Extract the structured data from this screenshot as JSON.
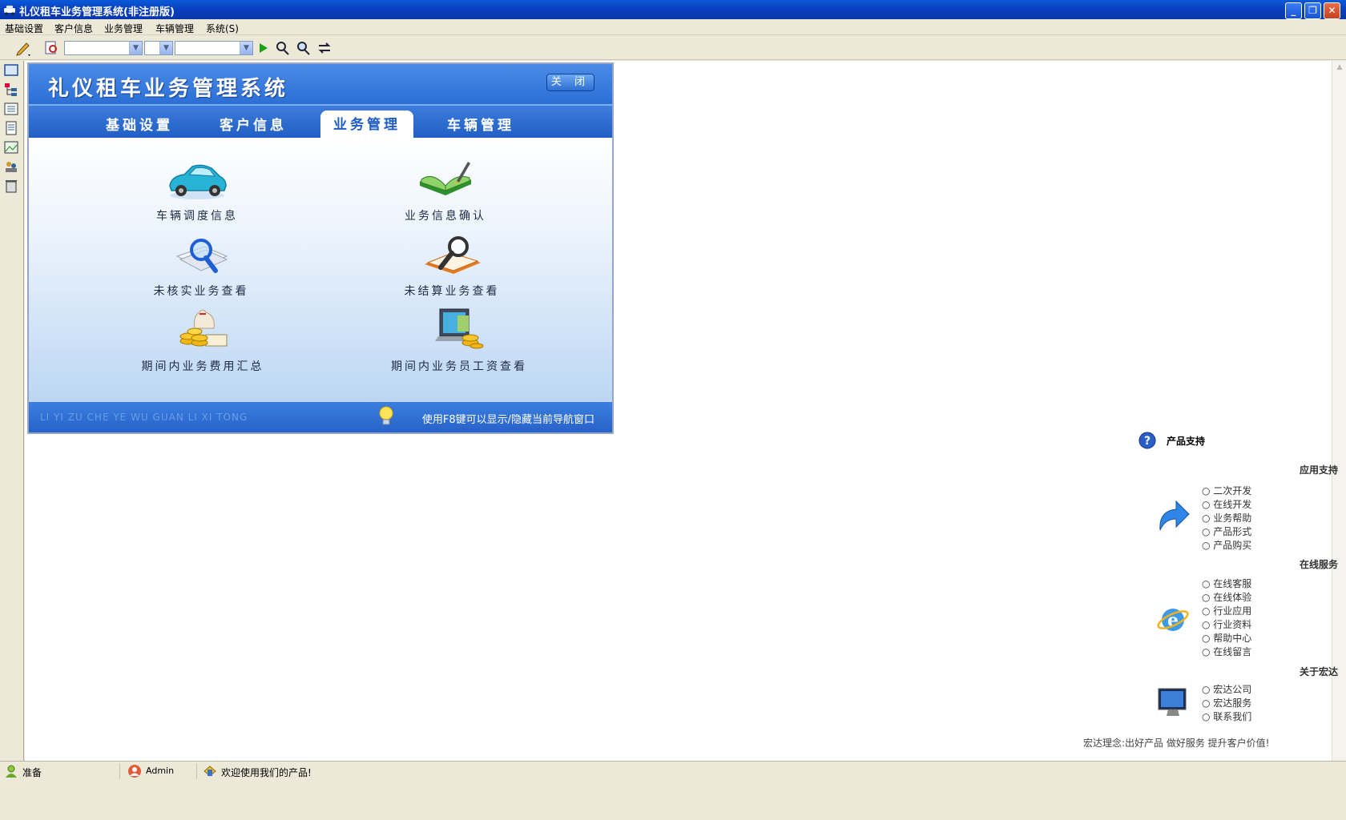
{
  "window": {
    "title": "礼仪租车业务管理系统(非注册版)"
  },
  "menu": [
    "基础设置",
    "客户信息",
    "业务管理",
    "车辆管理",
    "系统(S)"
  ],
  "nav": {
    "title": "礼仪租车业务管理系统",
    "close_label": "关 闭",
    "tabs": [
      "基础设置",
      "客户信息",
      "业务管理",
      "车辆管理"
    ],
    "active_tab": "业务管理",
    "items": [
      {
        "label": "车辆调度信息",
        "icon": "car-icon"
      },
      {
        "label": "业务信息确认",
        "icon": "book-pen-icon"
      },
      {
        "label": "未核实业务查看",
        "icon": "magnifier-document-icon"
      },
      {
        "label": "未结算业务查看",
        "icon": "magnifier-book-icon"
      },
      {
        "label": "期间内业务费用汇总",
        "icon": "coins-money-icon"
      },
      {
        "label": "期间内业务员工资查看",
        "icon": "computer-coins-icon"
      }
    ],
    "footer_pinyin": "LI YI ZU CHE YE WU GUAN LI XI TONG",
    "footer_hint": "使用F8键可以显示/隐藏当前导航窗口"
  },
  "support": {
    "heading": "产品支持",
    "sections": [
      {
        "title": "应用支持",
        "links": [
          "二次开发",
          "在线开发",
          "业务帮助",
          "产品形式",
          "产品购买"
        ]
      },
      {
        "title": "在线服务",
        "links": [
          "在线客服",
          "在线体验",
          "行业应用",
          "行业资料",
          "帮助中心",
          "在线留言"
        ]
      },
      {
        "title": "关于宏达",
        "links": [
          "宏达公司",
          "宏达服务",
          "联系我们"
        ]
      }
    ],
    "motto": "宏达理念:出好产品 做好服务 提升客户价值!"
  },
  "status": {
    "ready": "准备",
    "user": "Admin",
    "welcome": "欢迎使用我们的产品!"
  }
}
